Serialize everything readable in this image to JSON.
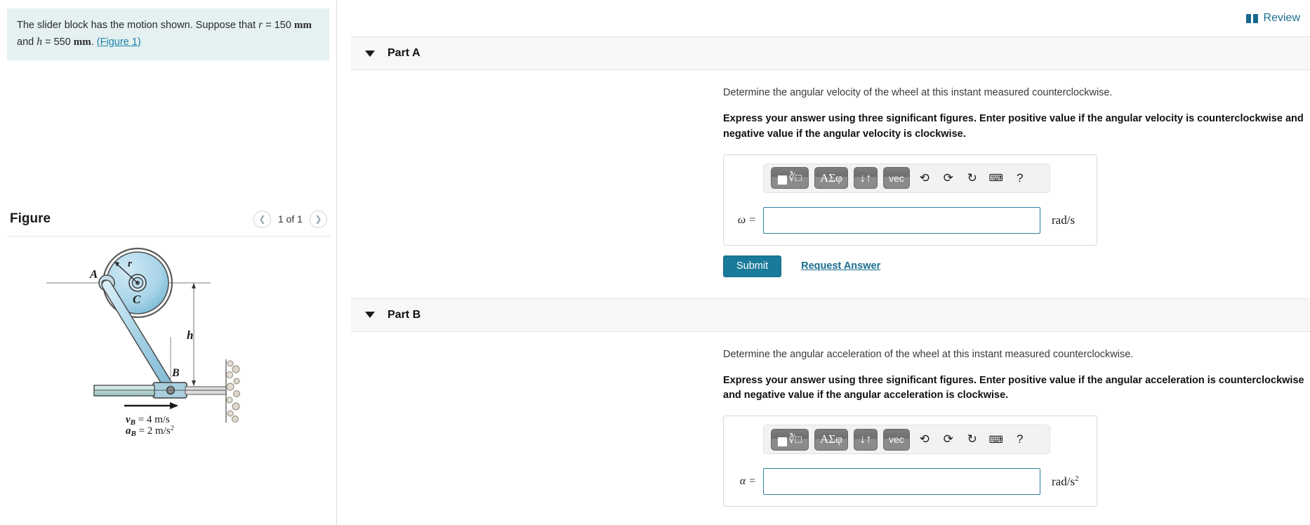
{
  "problem": {
    "text_1": "The slider block has the motion shown. Suppose that ",
    "var_r": "r",
    "eq_r": " = 150 ",
    "unit_r": "mm",
    "text_2": " and ",
    "var_h": "h",
    "eq_h": " = 550 ",
    "unit_h": "mm",
    "period": ". ",
    "figure_ref": "(Figure 1)"
  },
  "figure_panel": {
    "title": "Figure",
    "counter": "1 of 1",
    "prev_icon": "chevron-left-icon",
    "next_icon": "chevron-right-icon",
    "labels": {
      "point_A": "A",
      "point_B": "B",
      "point_C": "C",
      "radius": "r",
      "height": "h",
      "vB": "v",
      "vB_sub": "B",
      "vB_val": " = 4 m/s",
      "aB": "a",
      "aB_sub": "B",
      "aB_val": " = 2 m/s",
      "aB_exp": "2"
    }
  },
  "header": {
    "review_label": "Review",
    "review_icon": "book-icon"
  },
  "parts": [
    {
      "label": "Part A",
      "caret_icon": "caret-down-icon",
      "question": "Determine the angular velocity of the wheel at this instant measured counterclockwise.",
      "instruction": "Express your answer using three significant figures. Enter positive value if the angular velocity is counterclockwise and negative value if the angular velocity is clockwise.",
      "variable": "ω =",
      "input_value": "",
      "input_placeholder": "",
      "units": "rad/s",
      "units_exp": "",
      "submit_label": "Submit",
      "request_label": "Request Answer",
      "toolbar": [
        {
          "name": "template-button",
          "glyph": "√□"
        },
        {
          "name": "greek-button",
          "glyph": "ΑΣφ"
        },
        {
          "name": "sort-button",
          "glyph": "↓↑"
        },
        {
          "name": "vector-button",
          "glyph": "vec"
        },
        {
          "name": "undo-button",
          "glyph": "↩"
        },
        {
          "name": "redo-button",
          "glyph": "↪"
        },
        {
          "name": "reset-button",
          "glyph": "↺"
        },
        {
          "name": "keyboard-button",
          "glyph": "⌨"
        },
        {
          "name": "help-button",
          "glyph": "?"
        }
      ]
    },
    {
      "label": "Part B",
      "caret_icon": "caret-down-icon",
      "question": "Determine the angular acceleration of the wheel at this instant measured counterclockwise.",
      "instruction": "Express your answer using three significant figures. Enter positive value if the angular acceleration is counterclockwise and negative value if the angular acceleration is clockwise.",
      "variable": "α =",
      "input_value": "",
      "input_placeholder": "",
      "units": "rad/s",
      "units_exp": "2",
      "submit_label": "",
      "request_label": "",
      "toolbar": [
        {
          "name": "template-button",
          "glyph": "√□"
        },
        {
          "name": "greek-button",
          "glyph": "ΑΣφ"
        },
        {
          "name": "sort-button",
          "glyph": "↓↑"
        },
        {
          "name": "vector-button",
          "glyph": "vec"
        },
        {
          "name": "undo-button",
          "glyph": "↩"
        },
        {
          "name": "redo-button",
          "glyph": "↪"
        },
        {
          "name": "reset-button",
          "glyph": "↺"
        },
        {
          "name": "keyboard-button",
          "glyph": "⌨"
        },
        {
          "name": "help-button",
          "glyph": "?"
        }
      ]
    }
  ],
  "colors": {
    "accent": "#1a7a9a",
    "link": "#1a6e8e",
    "problem_bg": "#e4f1f0",
    "part_header_bg": "#f7f7f7",
    "input_border": "#2d7f9d"
  }
}
